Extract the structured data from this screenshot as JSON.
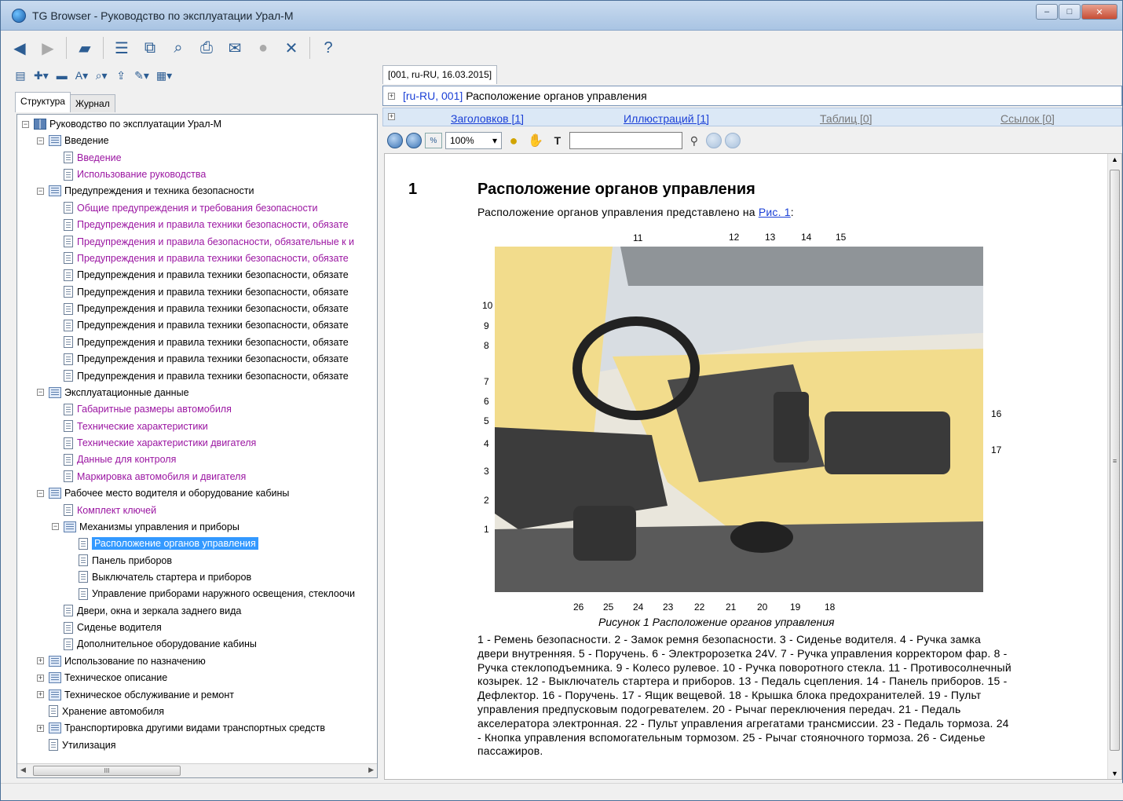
{
  "window": {
    "title": "TG Browser - Руководство по эксплуатации Урал-М",
    "min": "–",
    "max": "□",
    "close": "✕"
  },
  "left": {
    "tabs": [
      "Структура",
      "Журнал"
    ],
    "tree": [
      {
        "level": 0,
        "exp": "−",
        "icon": "book",
        "text": "Руководство по эксплуатации Урал-М",
        "link": false
      },
      {
        "level": 1,
        "exp": "−",
        "icon": "folder",
        "text": "Введение",
        "link": false
      },
      {
        "level": 2,
        "exp": "",
        "icon": "page",
        "text": "Введение",
        "link": true
      },
      {
        "level": 2,
        "exp": "",
        "icon": "page",
        "text": "Использование руководства",
        "link": true
      },
      {
        "level": 1,
        "exp": "−",
        "icon": "folder",
        "text": "Предупреждения и техника безопасности",
        "link": false
      },
      {
        "level": 2,
        "exp": "",
        "icon": "page",
        "text": "Общие предупреждения и требования безопасности",
        "link": true
      },
      {
        "level": 2,
        "exp": "",
        "icon": "page",
        "text": "Предупреждения и правила техники безопасности, обязате",
        "link": true
      },
      {
        "level": 2,
        "exp": "",
        "icon": "page",
        "text": "Предупреждения и правила безопасности, обязательные к и",
        "link": true
      },
      {
        "level": 2,
        "exp": "",
        "icon": "page",
        "text": "Предупреждения и правила техники безопасности, обязате",
        "link": true
      },
      {
        "level": 2,
        "exp": "",
        "icon": "page",
        "text": "Предупреждения и правила техники безопасности, обязате",
        "link": false
      },
      {
        "level": 2,
        "exp": "",
        "icon": "page",
        "text": "Предупреждения и правила техники безопасности, обязате",
        "link": false
      },
      {
        "level": 2,
        "exp": "",
        "icon": "page",
        "text": "Предупреждения и правила техники безопасности, обязате",
        "link": false
      },
      {
        "level": 2,
        "exp": "",
        "icon": "page",
        "text": "Предупреждения и правила техники безопасности, обязате",
        "link": false
      },
      {
        "level": 2,
        "exp": "",
        "icon": "page",
        "text": "Предупреждения и правила техники безопасности, обязате",
        "link": false
      },
      {
        "level": 2,
        "exp": "",
        "icon": "page",
        "text": "Предупреждения и правила техники безопасности, обязате",
        "link": false
      },
      {
        "level": 2,
        "exp": "",
        "icon": "page",
        "text": "Предупреждения и правила техники безопасности, обязате",
        "link": false
      },
      {
        "level": 1,
        "exp": "−",
        "icon": "folder",
        "text": "Эксплуатационные данные",
        "link": false
      },
      {
        "level": 2,
        "exp": "",
        "icon": "page",
        "text": "Габаритные размеры автомобиля",
        "link": true
      },
      {
        "level": 2,
        "exp": "",
        "icon": "page",
        "text": "Технические характеристики",
        "link": true
      },
      {
        "level": 2,
        "exp": "",
        "icon": "page",
        "text": "Технические характеристики двигателя",
        "link": true
      },
      {
        "level": 2,
        "exp": "",
        "icon": "page",
        "text": "Данные для контроля",
        "link": true
      },
      {
        "level": 2,
        "exp": "",
        "icon": "page",
        "text": "Маркировка автомобиля и двигателя",
        "link": true
      },
      {
        "level": 1,
        "exp": "−",
        "icon": "folder",
        "text": "Рабочее место водителя и оборудование кабины",
        "link": false
      },
      {
        "level": 2,
        "exp": "",
        "icon": "page",
        "text": "Комплект ключей",
        "link": true
      },
      {
        "level": 2,
        "exp": "−",
        "icon": "folder",
        "text": "Механизмы управления и приборы",
        "link": false
      },
      {
        "level": 3,
        "exp": "",
        "icon": "page",
        "text": "Расположение органов управления",
        "link": false,
        "selected": true
      },
      {
        "level": 3,
        "exp": "",
        "icon": "page",
        "text": "Панель приборов",
        "link": false
      },
      {
        "level": 3,
        "exp": "",
        "icon": "page",
        "text": "Выключатель стартера и приборов",
        "link": false
      },
      {
        "level": 3,
        "exp": "",
        "icon": "page",
        "text": "Управление приборами наружного освещения, стеклоочи",
        "link": false
      },
      {
        "level": 2,
        "exp": "",
        "icon": "page",
        "text": "Двери, окна и зеркала заднего вида",
        "link": false
      },
      {
        "level": 2,
        "exp": "",
        "icon": "page",
        "text": "Сиденье водителя",
        "link": false
      },
      {
        "level": 2,
        "exp": "",
        "icon": "page",
        "text": "Дополнительное оборудование кабины",
        "link": false
      },
      {
        "level": 1,
        "exp": "+",
        "icon": "folder",
        "text": "Использование по назначению",
        "link": false
      },
      {
        "level": 1,
        "exp": "+",
        "icon": "folder",
        "text": "Техническое описание",
        "link": false
      },
      {
        "level": 1,
        "exp": "+",
        "icon": "folder",
        "text": "Техническое обслуживание и ремонт",
        "link": false
      },
      {
        "level": 1,
        "exp": "",
        "icon": "page",
        "text": "Хранение автомобиля",
        "link": false
      },
      {
        "level": 1,
        "exp": "+",
        "icon": "folder",
        "text": "Транспортировка другими видами транспортных средств",
        "link": false
      },
      {
        "level": 1,
        "exp": "",
        "icon": "page",
        "text": "Утилизация",
        "link": false
      }
    ],
    "scroll_thumb": "III"
  },
  "doc": {
    "tab": "[001, ru-RU, 16.03.2015]",
    "header_link": "[ru-RU, 001]",
    "header_title": "Расположение органов управления",
    "counts": [
      "Заголовков [1]",
      "Иллюстраций [1]",
      "Таблиц [0]",
      "Ссылок [0]"
    ],
    "zoom": "100%",
    "section_number": "1",
    "section_title": "Расположение органов управления",
    "intro_text": "Расположение органов управления представлено на ",
    "intro_link": "Рис. 1",
    "intro_end": ":",
    "figure_caption": "Рисунок 1   Расположение органов управления",
    "callouts_top": [
      "11",
      "12",
      "13",
      "14",
      "15"
    ],
    "callouts_left": [
      "10",
      "9",
      "8",
      "7",
      "6",
      "5",
      "4",
      "3",
      "2",
      "1"
    ],
    "callouts_right": [
      "16",
      "17"
    ],
    "callouts_bottom": [
      "26",
      "25",
      "24",
      "23",
      "22",
      "21",
      "20",
      "19",
      "18"
    ],
    "legend": "1 - Ремень безопасности. 2 - Замок ремня безопасности. 3 - Сиденье водителя. 4 - Ручка замка двери внутренняя. 5 - Поручень. 6 - Электророзетка 24V. 7 - Ручка управления корректором фар. 8 - Ручка стеклоподъемника. 9 - Колесо рулевое. 10 - Ручка поворотного стекла. 11 - Противосолнечный козырек. 12 - Выключатель стартера и приборов. 13 - Педаль сцепления. 14 - Панель приборов. 15 - Дефлектор. 16 - Поручень. 17 - Ящик вещевой. 18 - Крышка блока предохранителей. 19 - Пульт управления предпусковым подогревателем. 20 - Рычаг переключения передач. 21 - Педаль акселератора электронная. 22 - Пульт управления агрегатами трансмиссии. 23 - Педаль тормоза. 24 - Кнопка управления вспомогательным тормозом. 25 - Рычаг стояночного тормоза. 26 - Сиденье пассажиров."
  },
  "colors": {
    "link": "#9b16a2",
    "selection": "#3399ff",
    "header_bg": "#dbe8f6",
    "cab_yellow": "#f2dc8c"
  }
}
